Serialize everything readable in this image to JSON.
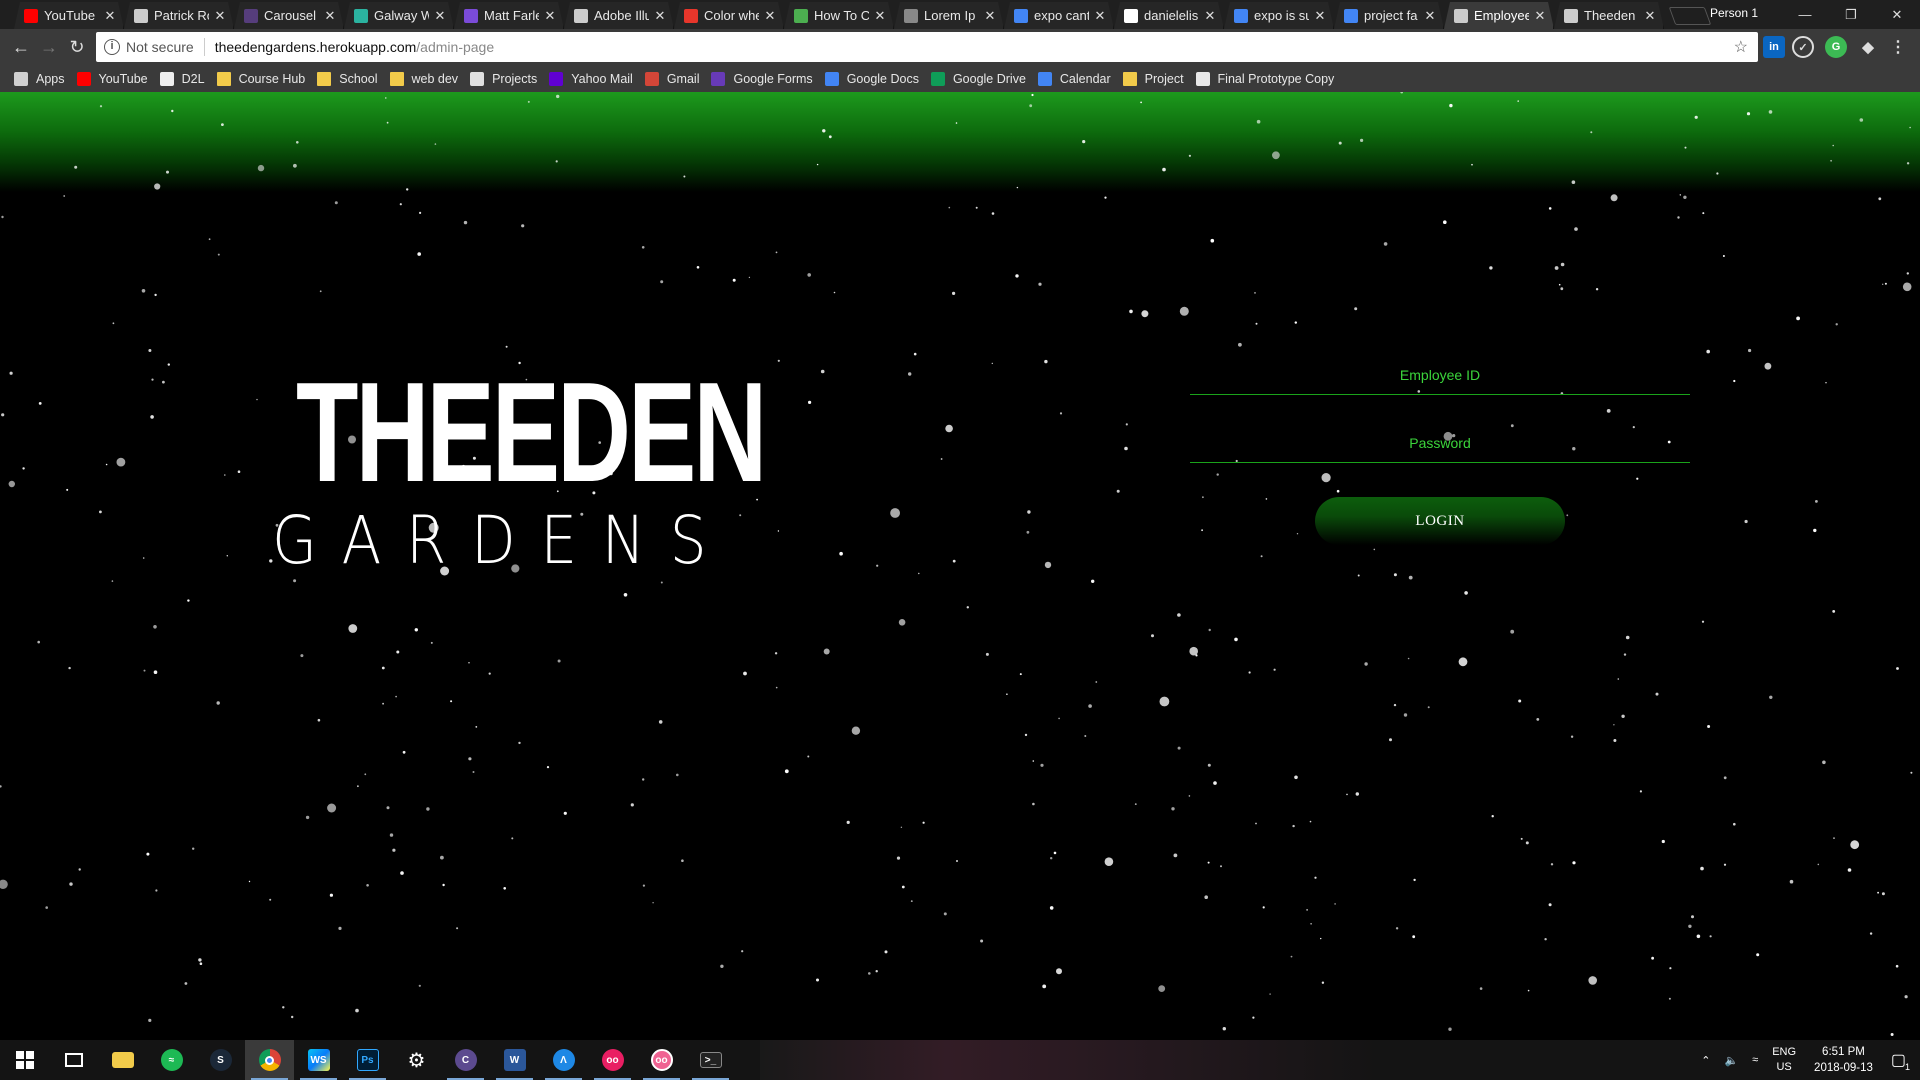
{
  "browser": {
    "tabs": [
      {
        "title": "YouTube",
        "icon": "youtube-icon",
        "color": "#ff0000"
      },
      {
        "title": "Patrick Ro",
        "icon": "page-icon",
        "color": "#cccccc"
      },
      {
        "title": "Carousel",
        "icon": "bootstrap-icon",
        "color": "#563d7c"
      },
      {
        "title": "Galway W",
        "icon": "galway-icon",
        "color": "#2bb3a0"
      },
      {
        "title": "Matt Farle",
        "icon": "wave-icon",
        "color": "#7b4bd8"
      },
      {
        "title": "Adobe Illu",
        "icon": "adobe-icon",
        "color": "#cccccc"
      },
      {
        "title": "Color whe",
        "icon": "adobe-color-icon",
        "color": "#e8362b"
      },
      {
        "title": "How To C",
        "icon": "chart-icon",
        "color": "#4caf50"
      },
      {
        "title": "Lorem Ip",
        "icon": "lorem-icon",
        "color": "#888888"
      },
      {
        "title": "expo cant",
        "icon": "google-icon",
        "color": "#4285f4"
      },
      {
        "title": "danielelis",
        "icon": "github-icon",
        "color": "#ffffff"
      },
      {
        "title": "expo is su",
        "icon": "google-icon",
        "color": "#4285f4"
      },
      {
        "title": "project fa",
        "icon": "google-icon",
        "color": "#4285f4"
      },
      {
        "title": "Employee",
        "icon": "page-icon",
        "color": "#cccccc",
        "active": true
      },
      {
        "title": "Theeden",
        "icon": "page-icon",
        "color": "#cccccc"
      }
    ],
    "profile": "Person 1",
    "url": {
      "security": "Not secure",
      "host": "theedengardens.herokuapp.com",
      "path": "/admin-page"
    },
    "bookmarks": [
      {
        "label": "Apps",
        "icon": "apps-icon"
      },
      {
        "label": "YouTube",
        "icon": "youtube-icon"
      },
      {
        "label": "D2L",
        "icon": "d2l-icon"
      },
      {
        "label": "Course Hub",
        "icon": "folder-icon"
      },
      {
        "label": "School",
        "icon": "folder-icon"
      },
      {
        "label": "web dev",
        "icon": "folder-icon"
      },
      {
        "label": "Projects",
        "icon": "projects-icon"
      },
      {
        "label": "Yahoo Mail",
        "icon": "yahoo-icon"
      },
      {
        "label": "Gmail",
        "icon": "gmail-icon"
      },
      {
        "label": "Google Forms",
        "icon": "forms-icon"
      },
      {
        "label": "Google Docs",
        "icon": "docs-icon"
      },
      {
        "label": "Google Drive",
        "icon": "drive-icon"
      },
      {
        "label": "Calendar",
        "icon": "calendar-icon"
      },
      {
        "label": "Project",
        "icon": "folder-icon"
      },
      {
        "label": "Final Prototype Copy",
        "icon": "sheet-icon"
      }
    ]
  },
  "page": {
    "logo_title": "THEEDEN",
    "logo_subtitle": "GARDENS",
    "employee_id_placeholder": "Employee ID",
    "password_placeholder": "Password",
    "login_label": "LOGIN",
    "accent_color": "#1aa31a"
  },
  "taskbar": {
    "apps": [
      "windows-start-icon",
      "task-view-icon",
      "file-explorer-icon",
      "spotify-icon",
      "steam-icon",
      "chrome-icon",
      "webstorm-icon",
      "photoshop-icon",
      "settings-icon",
      "app-icon",
      "word-icon",
      "arduino-icon",
      "app-icon",
      "app-icon",
      "terminal-icon"
    ],
    "lang_top": "ENG",
    "lang_bottom": "US",
    "time": "6:51 PM",
    "date": "2018-09-13",
    "notification_count": "1"
  }
}
